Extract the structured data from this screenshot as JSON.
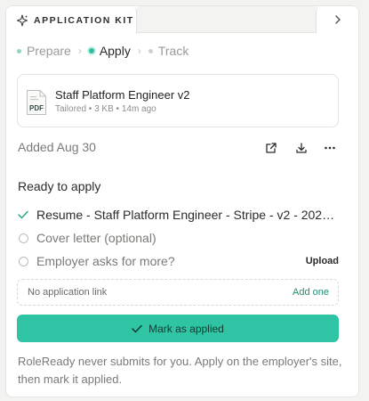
{
  "colors": {
    "accent": "#2ec4a4",
    "accent_dark": "#1f8d73",
    "check": "#2aa78b"
  },
  "tab": {
    "title": "APPLICATION KIT",
    "icon": "sparkle-icon",
    "expand_icon": "chevron-right-icon"
  },
  "steps": [
    {
      "label": "Prepare",
      "state": "done"
    },
    {
      "label": "Apply",
      "state": "current"
    },
    {
      "label": "Track",
      "state": "upcoming"
    }
  ],
  "file": {
    "icon": "pdf-file-icon",
    "icon_text": "PDF",
    "name": "Staff Platform Engineer v2",
    "meta": "Tailored • 3 KB • 14m ago"
  },
  "added": {
    "label": "Added Aug 30",
    "actions": [
      "external-link-icon",
      "download-icon",
      "more-icon"
    ]
  },
  "checklist": {
    "title": "Ready to apply",
    "items": [
      {
        "label": "Resume - Staff Platform Engineer - Stripe - v2 - 202…",
        "done": true,
        "action": ""
      },
      {
        "label": "Cover letter (optional)",
        "done": false,
        "action": ""
      },
      {
        "label": "Employer asks for more?",
        "done": false,
        "action": "Upload"
      }
    ]
  },
  "link": {
    "empty_label": "No application link",
    "add_label": "Add one"
  },
  "primary_button": {
    "label": "Mark as applied",
    "icon": "check-icon"
  },
  "footnote": "RoleReady never submits for you. Apply on the employer's site, then mark it applied."
}
